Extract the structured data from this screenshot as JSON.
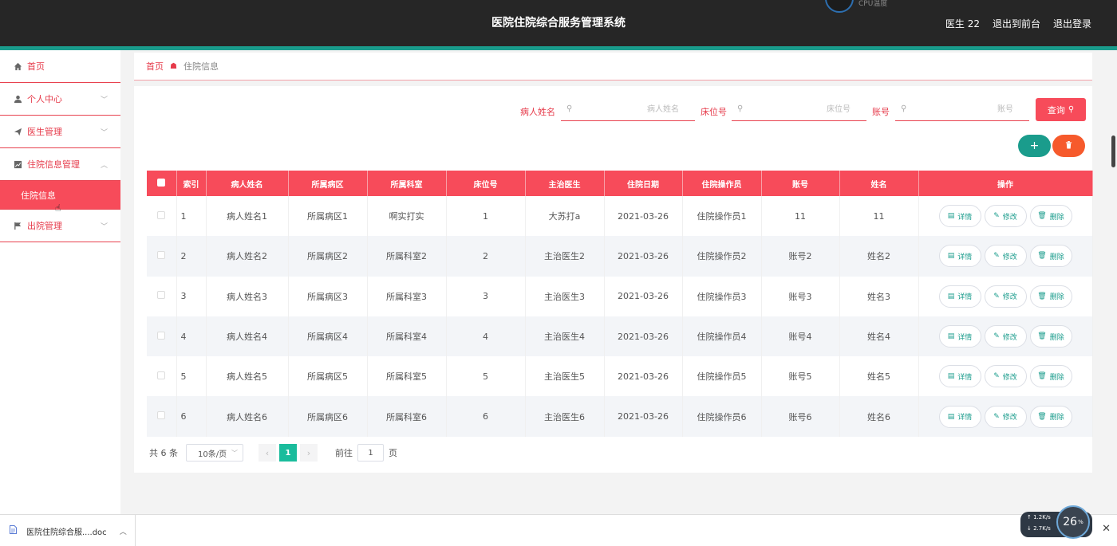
{
  "header": {
    "title": "医院住院综合服务管理系统",
    "cpu_label": "CPU温度",
    "user": "医生 22",
    "to_front": "退出到前台",
    "logout": "退出登录"
  },
  "sidebar": {
    "items": [
      {
        "label": "首页",
        "icon": "home-icon"
      },
      {
        "label": "个人中心",
        "icon": "person-icon"
      },
      {
        "label": "医生管理",
        "icon": "send-icon"
      },
      {
        "label": "住院信息管理",
        "icon": "chart-icon"
      },
      {
        "label": "出院管理",
        "icon": "flag-icon"
      }
    ],
    "sub_active": "住院信息"
  },
  "breadcrumb": {
    "home": "首页",
    "current": "住院信息"
  },
  "search": {
    "name_label": "病人姓名",
    "name_placeholder": "病人姓名",
    "bed_label": "床位号",
    "bed_placeholder": "床位号",
    "account_label": "账号",
    "account_placeholder": "账号",
    "query_button": "查询"
  },
  "actions": {
    "add_symbol": "+",
    "delete_symbol": "🗑"
  },
  "table": {
    "headers": [
      "索引",
      "病人姓名",
      "所属病区",
      "所属科室",
      "床位号",
      "主治医生",
      "住院日期",
      "住院操作员",
      "账号",
      "姓名",
      "操作"
    ],
    "rows": [
      [
        "1",
        "病人姓名1",
        "所属病区1",
        "啊实打实",
        "1",
        "大苏打a",
        "2021-03-26",
        "住院操作员1",
        "11",
        "11"
      ],
      [
        "2",
        "病人姓名2",
        "所属病区2",
        "所属科室2",
        "2",
        "主治医生2",
        "2021-03-26",
        "住院操作员2",
        "账号2",
        "姓名2"
      ],
      [
        "3",
        "病人姓名3",
        "所属病区3",
        "所属科室3",
        "3",
        "主治医生3",
        "2021-03-26",
        "住院操作员3",
        "账号3",
        "姓名3"
      ],
      [
        "4",
        "病人姓名4",
        "所属病区4",
        "所属科室4",
        "4",
        "主治医生4",
        "2021-03-26",
        "住院操作员4",
        "账号4",
        "姓名4"
      ],
      [
        "5",
        "病人姓名5",
        "所属病区5",
        "所属科室5",
        "5",
        "主治医生5",
        "2021-03-26",
        "住院操作员5",
        "账号5",
        "姓名5"
      ],
      [
        "6",
        "病人姓名6",
        "所属病区6",
        "所属科室6",
        "6",
        "主治医生6",
        "2021-03-26",
        "住院操作员6",
        "账号6",
        "姓名6"
      ]
    ],
    "ops": {
      "detail": "详情",
      "edit": "修改",
      "delete": "删除"
    }
  },
  "pager": {
    "total": "共 6 条",
    "page_size": "10条/页",
    "current_page": "1",
    "goto_prefix": "前往",
    "goto_value": "1",
    "goto_suffix": "页"
  },
  "download": {
    "file": "医院住院综合服....doc"
  },
  "net": {
    "up": "1.2",
    "up_unit": "K/s",
    "down": "2.7",
    "down_unit": "K/s",
    "usage": "26",
    "usage_unit": "%"
  },
  "colors": {
    "accent": "#f74b5a",
    "teal": "#1a9c8c",
    "orange": "#f65a2c",
    "header_bg": "#262626"
  }
}
